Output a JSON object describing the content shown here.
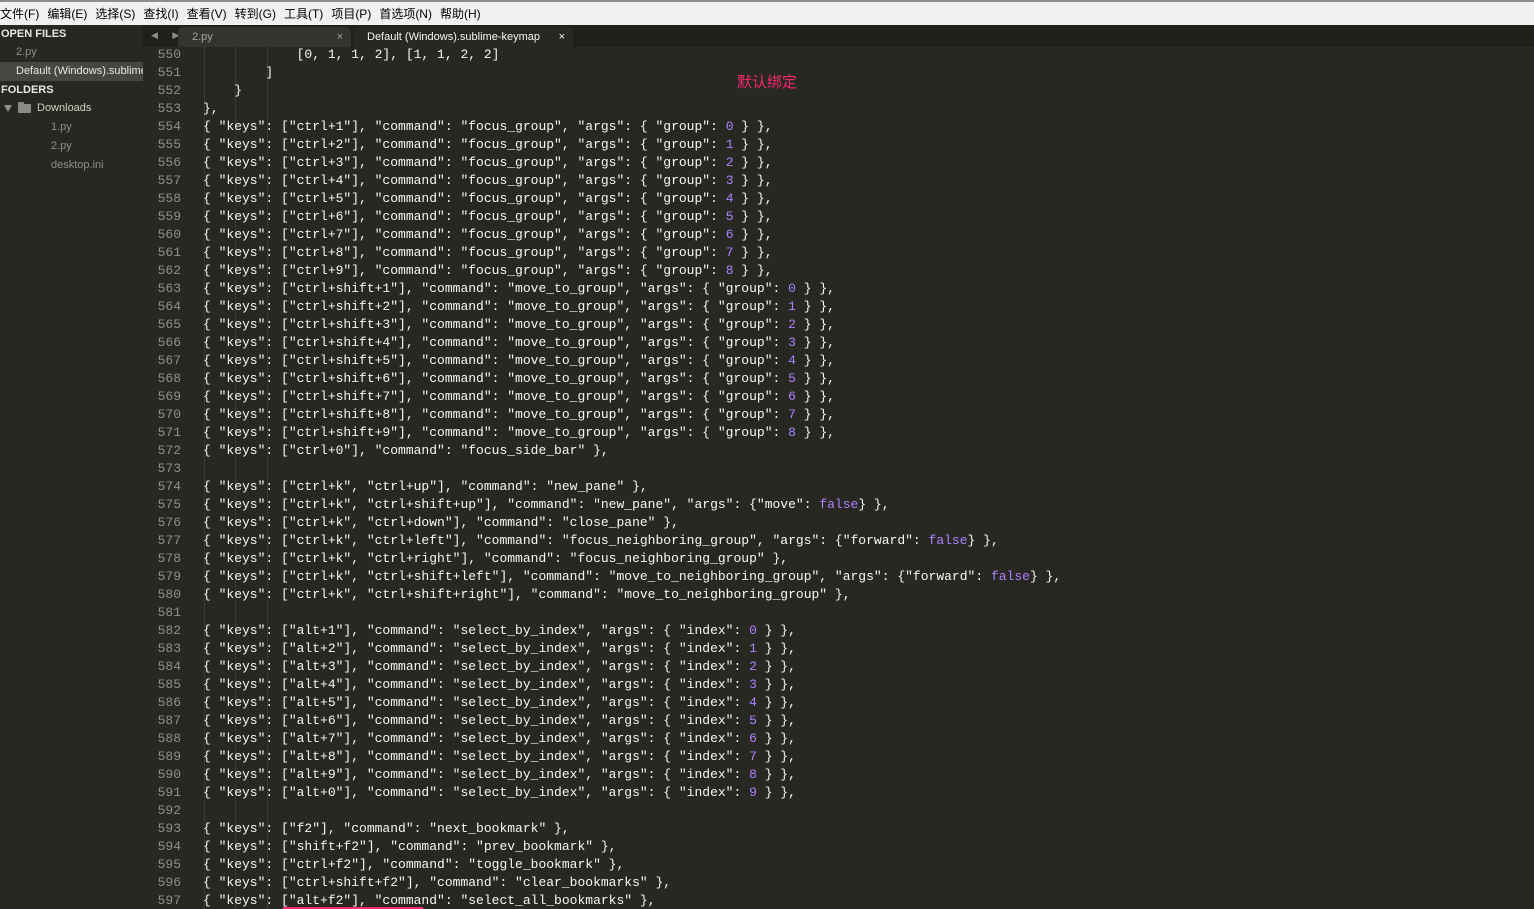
{
  "menu": [
    "文件(F)",
    "编辑(E)",
    "选择(S)",
    "查找(I)",
    "查看(V)",
    "转到(G)",
    "工具(T)",
    "项目(P)",
    "首选项(N)",
    "帮助(H)"
  ],
  "sidebar": {
    "open_files_heading": "OPEN FILES",
    "open_files": [
      "2.py",
      "Default (Windows).sublime-keymap"
    ],
    "folders_heading": "FOLDERS",
    "folder_name": "Downloads",
    "folder_files": [
      "1.py",
      "2.py",
      "desktop.ini"
    ]
  },
  "tabs": [
    {
      "label": "2.py",
      "close": "×"
    },
    {
      "label": "Default (Windows).sublime-keymap",
      "close": "×"
    }
  ],
  "tab_nav": "◀ ▶",
  "annotation": "默认绑定",
  "colors": {
    "background": "#272822",
    "number": "#ae81ff",
    "annotation": "#f92672",
    "text": "#f8f8f2"
  },
  "code_lines": [
    {
      "n": "550",
      "t": "            [0, 1, 1, 2], [1, 1, 2, 2]"
    },
    {
      "n": "551",
      "t": "        ]"
    },
    {
      "n": "552",
      "t": "    }"
    },
    {
      "n": "553",
      "t": "},"
    },
    {
      "n": "554",
      "t": "{ \"keys\": [\"ctrl+1\"], \"command\": \"focus_group\", \"args\": { \"group\": 0 } },"
    },
    {
      "n": "555",
      "t": "{ \"keys\": [\"ctrl+2\"], \"command\": \"focus_group\", \"args\": { \"group\": 1 } },"
    },
    {
      "n": "556",
      "t": "{ \"keys\": [\"ctrl+3\"], \"command\": \"focus_group\", \"args\": { \"group\": 2 } },"
    },
    {
      "n": "557",
      "t": "{ \"keys\": [\"ctrl+4\"], \"command\": \"focus_group\", \"args\": { \"group\": 3 } },"
    },
    {
      "n": "558",
      "t": "{ \"keys\": [\"ctrl+5\"], \"command\": \"focus_group\", \"args\": { \"group\": 4 } },"
    },
    {
      "n": "559",
      "t": "{ \"keys\": [\"ctrl+6\"], \"command\": \"focus_group\", \"args\": { \"group\": 5 } },"
    },
    {
      "n": "560",
      "t": "{ \"keys\": [\"ctrl+7\"], \"command\": \"focus_group\", \"args\": { \"group\": 6 } },"
    },
    {
      "n": "561",
      "t": "{ \"keys\": [\"ctrl+8\"], \"command\": \"focus_group\", \"args\": { \"group\": 7 } },"
    },
    {
      "n": "562",
      "t": "{ \"keys\": [\"ctrl+9\"], \"command\": \"focus_group\", \"args\": { \"group\": 8 } },"
    },
    {
      "n": "563",
      "t": "{ \"keys\": [\"ctrl+shift+1\"], \"command\": \"move_to_group\", \"args\": { \"group\": 0 } },"
    },
    {
      "n": "564",
      "t": "{ \"keys\": [\"ctrl+shift+2\"], \"command\": \"move_to_group\", \"args\": { \"group\": 1 } },"
    },
    {
      "n": "565",
      "t": "{ \"keys\": [\"ctrl+shift+3\"], \"command\": \"move_to_group\", \"args\": { \"group\": 2 } },"
    },
    {
      "n": "566",
      "t": "{ \"keys\": [\"ctrl+shift+4\"], \"command\": \"move_to_group\", \"args\": { \"group\": 3 } },"
    },
    {
      "n": "567",
      "t": "{ \"keys\": [\"ctrl+shift+5\"], \"command\": \"move_to_group\", \"args\": { \"group\": 4 } },"
    },
    {
      "n": "568",
      "t": "{ \"keys\": [\"ctrl+shift+6\"], \"command\": \"move_to_group\", \"args\": { \"group\": 5 } },"
    },
    {
      "n": "569",
      "t": "{ \"keys\": [\"ctrl+shift+7\"], \"command\": \"move_to_group\", \"args\": { \"group\": 6 } },"
    },
    {
      "n": "570",
      "t": "{ \"keys\": [\"ctrl+shift+8\"], \"command\": \"move_to_group\", \"args\": { \"group\": 7 } },"
    },
    {
      "n": "571",
      "t": "{ \"keys\": [\"ctrl+shift+9\"], \"command\": \"move_to_group\", \"args\": { \"group\": 8 } },"
    },
    {
      "n": "572",
      "t": "{ \"keys\": [\"ctrl+0\"], \"command\": \"focus_side_bar\" },"
    },
    {
      "n": "573",
      "t": ""
    },
    {
      "n": "574",
      "t": "{ \"keys\": [\"ctrl+k\", \"ctrl+up\"], \"command\": \"new_pane\" },"
    },
    {
      "n": "575",
      "t": "{ \"keys\": [\"ctrl+k\", \"ctrl+shift+up\"], \"command\": \"new_pane\", \"args\": {\"move\": false} },"
    },
    {
      "n": "576",
      "t": "{ \"keys\": [\"ctrl+k\", \"ctrl+down\"], \"command\": \"close_pane\" },"
    },
    {
      "n": "577",
      "t": "{ \"keys\": [\"ctrl+k\", \"ctrl+left\"], \"command\": \"focus_neighboring_group\", \"args\": {\"forward\": false} },"
    },
    {
      "n": "578",
      "t": "{ \"keys\": [\"ctrl+k\", \"ctrl+right\"], \"command\": \"focus_neighboring_group\" },"
    },
    {
      "n": "579",
      "t": "{ \"keys\": [\"ctrl+k\", \"ctrl+shift+left\"], \"command\": \"move_to_neighboring_group\", \"args\": {\"forward\": false} },"
    },
    {
      "n": "580",
      "t": "{ \"keys\": [\"ctrl+k\", \"ctrl+shift+right\"], \"command\": \"move_to_neighboring_group\" },"
    },
    {
      "n": "581",
      "t": ""
    },
    {
      "n": "582",
      "t": "{ \"keys\": [\"alt+1\"], \"command\": \"select_by_index\", \"args\": { \"index\": 0 } },"
    },
    {
      "n": "583",
      "t": "{ \"keys\": [\"alt+2\"], \"command\": \"select_by_index\", \"args\": { \"index\": 1 } },"
    },
    {
      "n": "584",
      "t": "{ \"keys\": [\"alt+3\"], \"command\": \"select_by_index\", \"args\": { \"index\": 2 } },"
    },
    {
      "n": "585",
      "t": "{ \"keys\": [\"alt+4\"], \"command\": \"select_by_index\", \"args\": { \"index\": 3 } },"
    },
    {
      "n": "586",
      "t": "{ \"keys\": [\"alt+5\"], \"command\": \"select_by_index\", \"args\": { \"index\": 4 } },"
    },
    {
      "n": "587",
      "t": "{ \"keys\": [\"alt+6\"], \"command\": \"select_by_index\", \"args\": { \"index\": 5 } },"
    },
    {
      "n": "588",
      "t": "{ \"keys\": [\"alt+7\"], \"command\": \"select_by_index\", \"args\": { \"index\": 6 } },"
    },
    {
      "n": "589",
      "t": "{ \"keys\": [\"alt+8\"], \"command\": \"select_by_index\", \"args\": { \"index\": 7 } },"
    },
    {
      "n": "590",
      "t": "{ \"keys\": [\"alt+9\"], \"command\": \"select_by_index\", \"args\": { \"index\": 8 } },"
    },
    {
      "n": "591",
      "t": "{ \"keys\": [\"alt+0\"], \"command\": \"select_by_index\", \"args\": { \"index\": 9 } },"
    },
    {
      "n": "592",
      "t": ""
    },
    {
      "n": "593",
      "t": "{ \"keys\": [\"f2\"], \"command\": \"next_bookmark\" },"
    },
    {
      "n": "594",
      "t": "{ \"keys\": [\"shift+f2\"], \"command\": \"prev_bookmark\" },"
    },
    {
      "n": "595",
      "t": "{ \"keys\": [\"ctrl+f2\"], \"command\": \"toggle_bookmark\" },"
    },
    {
      "n": "596",
      "t": "{ \"keys\": [\"ctrl+shift+f2\"], \"command\": \"clear_bookmarks\" },"
    },
    {
      "n": "597",
      "t": "{ \"keys\": [\"alt+f2\"], \"command\": \"select_all_bookmarks\" },"
    }
  ]
}
